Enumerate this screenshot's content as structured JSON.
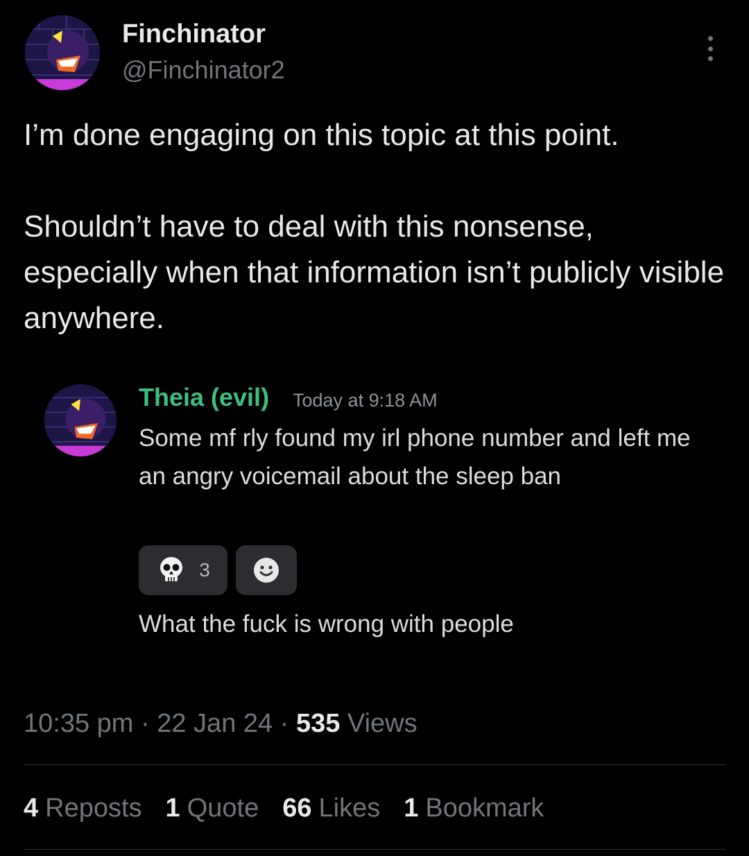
{
  "author": {
    "display_name": "Finchinator",
    "handle": "@Finchinator2"
  },
  "tweet": {
    "text": "I’m done engaging on this topic at this point.\n\nShouldn’t have to deal with this nonsense, especially when that information isn’t publicly visible anywhere."
  },
  "embed": {
    "username": "Theia (evil)",
    "timestamp": "Today at 9:18 AM",
    "message": "Some mf rly found my irl phone number and left me an angry voicemail about the sleep ban",
    "reactions": [
      {
        "emoji": "💀",
        "icon": "skull-icon",
        "count": "3"
      },
      {
        "emoji": "add-reaction",
        "icon": "smiley-icon",
        "count": ""
      }
    ],
    "followup_message": "What the fuck is wrong with people"
  },
  "meta": {
    "time": "10:35 pm",
    "date": "22 Jan 24",
    "views_count": "535",
    "views_label": "Views"
  },
  "stats": {
    "reposts_count": "4",
    "reposts_label": "Reposts",
    "quotes_count": "1",
    "quotes_label": "Quote",
    "likes_count": "66",
    "likes_label": "Likes",
    "bookmarks_count": "1",
    "bookmarks_label": "Bookmark"
  },
  "colors": {
    "background": "#000000",
    "discord_username": "#3fbf7f",
    "muted": "#71767b"
  }
}
